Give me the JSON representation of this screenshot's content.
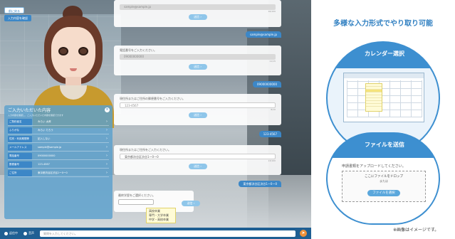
{
  "app": {
    "prev_button": "前に戻る",
    "first_button": "入力内容を確認",
    "chat": {
      "email_card": {
        "placeholder": "sample@sample.jp",
        "count": "16/100",
        "send": "送信 ›"
      },
      "email_reply": "sample@sample.jp",
      "phone_card": {
        "label": "電話番号をご入力ください。",
        "placeholder": "09000000000",
        "count": "11/15",
        "send": "送信 ›"
      },
      "phone_reply": "09000000000",
      "zip_card": {
        "label": "現住所またはご住所の郵便番号をご入力ください。",
        "value": "123-4567",
        "count": "8/10",
        "send": "送信 ›"
      },
      "zip_reply": "123-4567",
      "address_card": {
        "label": "現住所またはご住所をご入力ください。",
        "value": "東京都渋谷区渋谷1ー0ー0",
        "count": "13/100",
        "send": "送信 ›"
      },
      "address_reply": "東京都渋谷区渋谷1ー0ー0",
      "education_card": {
        "label": "最終学歴をご選択ください。",
        "send": "送信 ›"
      },
      "education_options": [
        "高校卒業",
        "専門・大学卒業",
        "中学・高校卒業"
      ]
    },
    "summary": {
      "title": "ご入力いただいた内容",
      "subtitle": "入力内容を確認し、ご入力いただいた内容を確認できます",
      "rows": [
        {
          "label": "ご契約者名",
          "value": "みらい 太郎"
        },
        {
          "label": "ふりがな",
          "value": "みらい たろう"
        },
        {
          "label": "性別・利用期間等",
          "value": "記入しない"
        },
        {
          "label": "メールアドレス",
          "value": "sample@sample.jp"
        },
        {
          "label": "電話番号",
          "value": "09000000000"
        },
        {
          "label": "郵便番号",
          "value": "123-4567"
        },
        {
          "label": "ご住所",
          "value": "東京都渋谷区渋谷1ー0ー0"
        }
      ]
    },
    "bottom_bar": {
      "item1": "返信中",
      "item2": "音声",
      "input_placeholder": "質問を入力してください。",
      "send_icon": "➤"
    }
  },
  "promo": {
    "title": "多様な入力形式でやり取り可能",
    "calendar_heading": "カレンダー選択",
    "file_heading": "ファイルを送信",
    "file_label": "申請書類をアップロードしてください。",
    "drop_text": "ここにファイルをドロップ",
    "drop_or": "または",
    "drop_button": "ファイルを選択"
  },
  "note": "※画像はイメージです。",
  "colors": {
    "accent": "#3c87c7",
    "circle": "#3d8fd0",
    "bottom_bar": "#1f5f93",
    "send": "#f0913a"
  }
}
